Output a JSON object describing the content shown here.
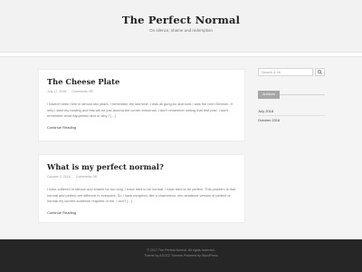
{
  "site": {
    "title": "The Perfect Normal",
    "tagline": "On silence, shame and redemption"
  },
  "posts": [
    {
      "title": "The Cheese Plate",
      "date": "July 17, 2018",
      "comments": "Comments Off",
      "excerpt": "I haven't been here in almost two years. I remember the last time. I was all gung-ho and sure I was the next Glennon. If only I start my healing and this will be just around the corner tomorrow. I don't remember writing that first post. I don't remember what happened next or why I […]",
      "continue": "Continue Reading"
    },
    {
      "title": "What is my perfect normal?",
      "date": "October 3, 2016",
      "comments": "Comments Off",
      "excerpt": "I have suffered in silence and shame for too long. I have tried to be normal. I have tried to be perfect. This problem is that normal and perfect are different to everyone. So I have morphed, like a chameleon, into whatever version of perfect or normal my current audience requires of me. I don't […]",
      "continue": "Continue Reading"
    }
  ],
  "sidebar": {
    "search_placeholder": "Search & hit",
    "archives_label": "Archives",
    "archives": [
      "July 2018",
      "October 2016"
    ]
  },
  "footer": {
    "copyright": "© 2017 The Perfect Normal. All rights reserved.",
    "credit": "Theme by ASOZZ Themes Powered by WordPress"
  }
}
